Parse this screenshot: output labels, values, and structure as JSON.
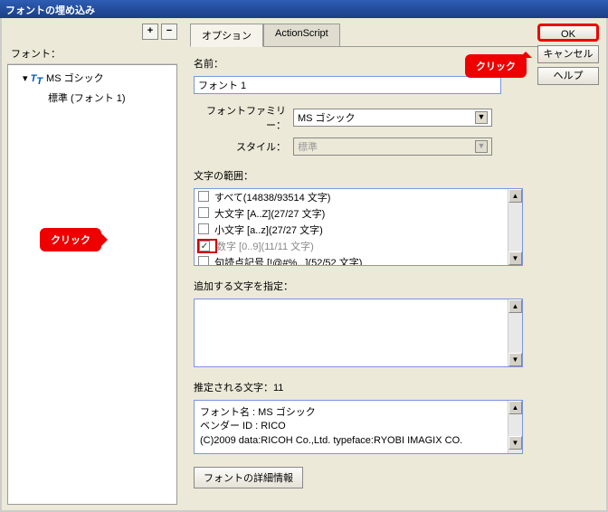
{
  "title": "フォントの埋め込み",
  "buttons": {
    "ok": "OK",
    "cancel": "キャンセル",
    "help": "ヘルプ",
    "plus": "+",
    "minus": "−"
  },
  "callout": {
    "click": "クリック"
  },
  "tree": {
    "header": "フォント：",
    "font_name": "MS ゴシック",
    "font_sub": "標準 (フォント 1)"
  },
  "tabs": {
    "option": "オプション",
    "as": "ActionScript"
  },
  "form": {
    "name_lbl": "名前：",
    "name_val": "フォント 1",
    "family_lbl": "フォントファミリー：",
    "family_val": "MS ゴシック",
    "style_lbl": "スタイル：",
    "style_val": "標準"
  },
  "range": {
    "label": "文字の範囲：",
    "items": [
      {
        "label": "すべて",
        "detail": "(14838/93514 文字)",
        "checked": false,
        "selected": false
      },
      {
        "label": "大文字 [A..Z]",
        "detail": "(27/27 文字)",
        "checked": false,
        "selected": false
      },
      {
        "label": "小文字 [a..z]",
        "detail": "(27/27 文字)",
        "checked": false,
        "selected": false
      },
      {
        "label": "数字 [0..9]",
        "detail": "(11/11 文字)",
        "checked": true,
        "selected": true
      },
      {
        "label": "句読点記号 [!@#%...]",
        "detail": "(52/52 文字)",
        "checked": false,
        "selected": false
      }
    ]
  },
  "extra_chars_lbl": "追加する文字を指定：",
  "estimated_lbl": "推定される文字：11",
  "info": {
    "l1": "フォント名 : MS ゴシック",
    "l2": "ベンダー ID : RICO",
    "l3": "(C)2009 data:RICOH Co.,Ltd. typeface:RYOBI IMAGIX CO."
  },
  "detail_btn": "フォントの詳細情報"
}
